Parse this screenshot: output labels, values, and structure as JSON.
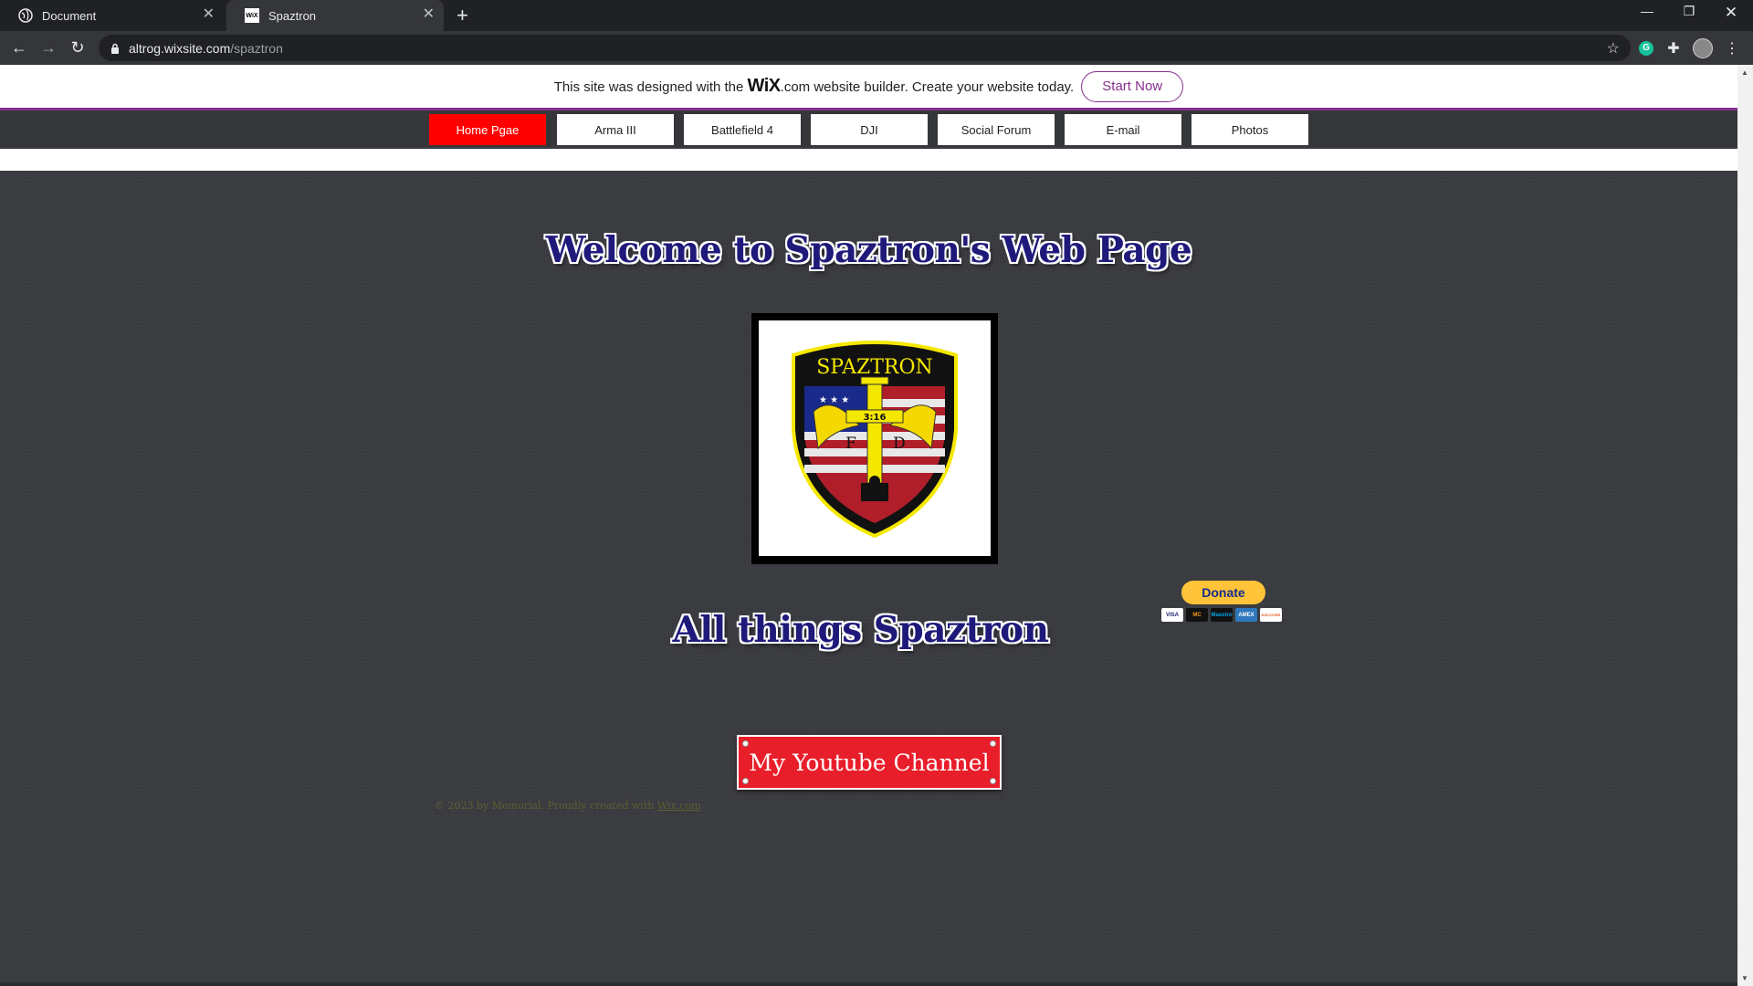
{
  "browser": {
    "tabs": [
      {
        "title": "Document",
        "active": false
      },
      {
        "title": "Spaztron",
        "active": true
      }
    ],
    "url_host": "altrog.wixsite.com",
    "url_path": "/spaztron",
    "favicon_wix_text": "WiX"
  },
  "wix_banner": {
    "message_before": "This site was designed with the ",
    "logo_text": "WiX",
    "logo_suffix": ".com",
    "message_after": " website builder. Create your website today.",
    "button_label": "Start Now",
    "accent_color": "#862f8c"
  },
  "menu": {
    "items": [
      {
        "label": "Home Pgae",
        "active": true
      },
      {
        "label": "Arma III",
        "active": false
      },
      {
        "label": "Battlefield 4",
        "active": false
      },
      {
        "label": "DJI",
        "active": false
      },
      {
        "label": "Social Forum",
        "active": false
      },
      {
        "label": "E-mail",
        "active": false
      },
      {
        "label": "Photos",
        "active": false
      }
    ],
    "active_color": "#ff0000"
  },
  "page": {
    "welcome_heading": "Welcome to Spaztron's Web Page",
    "logo": {
      "top_text": "SPAZTRON",
      "cross_text": "3:16",
      "letter_left": "F",
      "letter_right": "D"
    },
    "sub_heading": "All things Spaztron",
    "donate_label": "Donate",
    "card_labels": [
      "VISA",
      "MC",
      "Maestro",
      "AMEX",
      "DISCOVER"
    ],
    "youtube_button": "My Youtube Channel",
    "footer_text": "© 2023 by  Memorial. Proudly created with ",
    "footer_link": "Wix.com"
  }
}
